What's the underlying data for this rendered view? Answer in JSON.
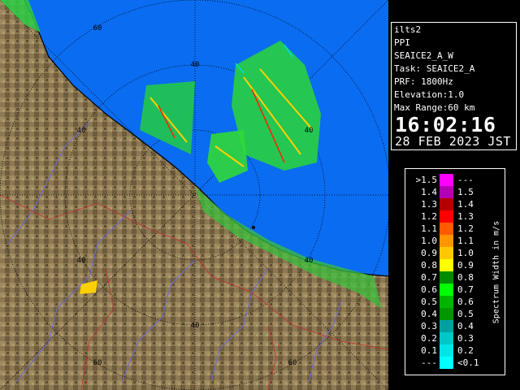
{
  "info": {
    "site": "ilts2",
    "mode": "PPI",
    "scan": "SEAICE2_A_W",
    "task": "Task: SEAICE2_A",
    "prf": "PRF: 1800Hz",
    "elevation": "Elevation:1.0",
    "max_range": "Max Range:60 km",
    "time": "16:02:16",
    "date": "28 FEB 2023 JST"
  },
  "map": {
    "range_labels": [
      "60",
      "40",
      "40",
      "40",
      "40",
      "40",
      "60"
    ],
    "colors": {
      "sea": "#0a6cf0",
      "land": "#8a7650",
      "background": "#000000"
    }
  },
  "legend": {
    "title": "Spectrum Width in m/s",
    "rows": [
      {
        "left": ">1.5",
        "right": "---",
        "color": "#ff00ff"
      },
      {
        "left": "1.4",
        "right": "1.5",
        "color": "#b400b4"
      },
      {
        "left": "1.3",
        "right": "1.4",
        "color": "#b40000"
      },
      {
        "left": "1.2",
        "right": "1.3",
        "color": "#ff0000"
      },
      {
        "left": "1.1",
        "right": "1.2",
        "color": "#ff5a00"
      },
      {
        "left": "1.0",
        "right": "1.1",
        "color": "#ff9600"
      },
      {
        "left": "0.9",
        "right": "1.0",
        "color": "#ffc800"
      },
      {
        "left": "0.8",
        "right": "0.9",
        "color": "#ffff00"
      },
      {
        "left": "0.7",
        "right": "0.8",
        "color": "#008c00"
      },
      {
        "left": "0.6",
        "right": "0.7",
        "color": "#00ff00"
      },
      {
        "left": "0.5",
        "right": "0.6",
        "color": "#00b400"
      },
      {
        "left": "0.4",
        "right": "0.5",
        "color": "#009600"
      },
      {
        "left": "0.3",
        "right": "0.4",
        "color": "#00a0a0"
      },
      {
        "left": "0.2",
        "right": "0.3",
        "color": "#00c8c8"
      },
      {
        "left": "0.1",
        "right": "0.2",
        "color": "#00e6e6"
      },
      {
        "left": "---",
        "right": "<0.1",
        "color": "#00ffff"
      }
    ]
  }
}
